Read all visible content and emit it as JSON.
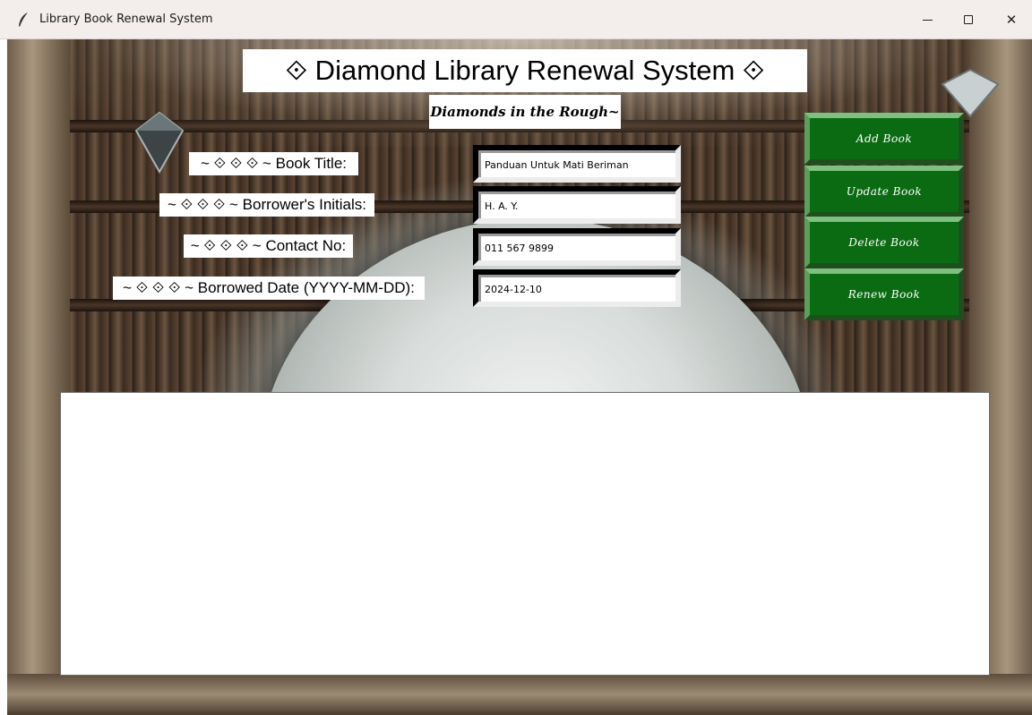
{
  "window": {
    "title": "Library Book Renewal System",
    "icon": "feather-icon",
    "controls": {
      "minimize": "minimize-icon",
      "maximize": "maximize-icon",
      "close_glyph": "✕"
    }
  },
  "header": {
    "title": "⟐ Diamond Library Renewal System ⟐",
    "subtitle": "Diamonds in the Rough~"
  },
  "form": {
    "book_title": {
      "label": "~ ⟐ ⟐ ⟐ ~ Book Title:",
      "value": "Panduan Untuk Mati Beriman"
    },
    "borrower_initials": {
      "label": "~ ⟐ ⟐ ⟐ ~ Borrower's Initials:",
      "value": "H. A. Y."
    },
    "contact_no": {
      "label": "~ ⟐ ⟐ ⟐ ~ Contact No:",
      "value": "011 567 9899"
    },
    "borrowed_date": {
      "label": "~ ⟐ ⟐ ⟐ ~ Borrowed Date (YYYY-MM-DD):",
      "value": "2024-12-10"
    }
  },
  "actions": {
    "add": "Add Book",
    "update": "Update Book",
    "delete": "Delete Book",
    "renew": "Renew Book"
  },
  "records": [],
  "colors": {
    "button_green": "#0b6b12",
    "titlebar": "#f3eeec",
    "background_wood": "#3a2c22"
  }
}
